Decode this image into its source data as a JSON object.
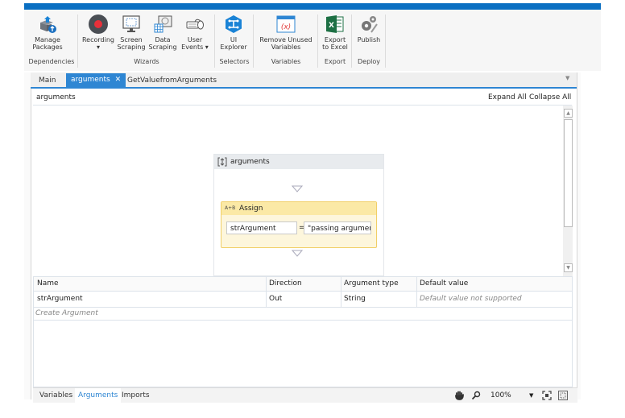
{
  "ribbon": {
    "buttons": [
      {
        "id": "manage-packages",
        "line1": "Manage",
        "line2": "Packages"
      },
      {
        "id": "recording",
        "line1": "Recording",
        "line2": "▾"
      },
      {
        "id": "screen-scraping",
        "line1": "Screen",
        "line2": "Scraping"
      },
      {
        "id": "data-scraping",
        "line1": "Data",
        "line2": "Scraping"
      },
      {
        "id": "user-events",
        "line1": "User",
        "line2": "Events ▾"
      },
      {
        "id": "ui-explorer",
        "line1": "UI",
        "line2": "Explorer"
      },
      {
        "id": "remove-unused-variables",
        "line1": "Remove Unused",
        "line2": "Variables"
      },
      {
        "id": "export-to-excel",
        "line1": "Export",
        "line2": "to Excel"
      },
      {
        "id": "publish",
        "line1": "Publish",
        "line2": ""
      }
    ],
    "groups": [
      "Dependencies",
      "Wizards",
      "Selectors",
      "Variables",
      "Export",
      "Deploy"
    ],
    "colors": {
      "recording_dot": "#e8303a",
      "ui_explorer": "#1a83d6",
      "excel": "#1d7044",
      "accent": "#0a6fc2"
    }
  },
  "doc_tabs": [
    {
      "label": "Main",
      "active": false
    },
    {
      "label": "arguments",
      "active": true,
      "close": "✕"
    },
    {
      "label": "GetValuefromArguments",
      "active": false
    }
  ],
  "breadcrumb": "arguments",
  "expand_all": "Expand All",
  "collapse_all": "Collapse All",
  "sequence": {
    "title": "arguments",
    "assign": {
      "title": "Assign",
      "icon_label": "A+B",
      "to": "strArgument",
      "equals": "=",
      "value": "\"passing argument"
    }
  },
  "arguments_table": {
    "headers": [
      "Name",
      "Direction",
      "Argument type",
      "Default value"
    ],
    "rows": [
      {
        "name": "strArgument",
        "direction": "Out",
        "type": "String",
        "default": "Default value not supported"
      }
    ],
    "create_label": "Create Argument"
  },
  "bottom_tabs": [
    {
      "label": "Variables",
      "active": false
    },
    {
      "label": "Arguments",
      "active": true
    },
    {
      "label": "Imports",
      "active": false
    }
  ],
  "zoom_level": "100%"
}
